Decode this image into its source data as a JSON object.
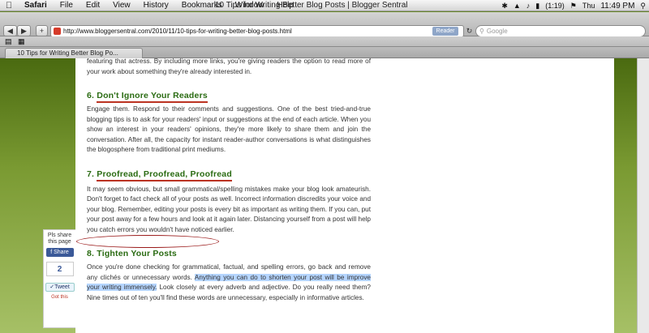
{
  "menubar": {
    "app": "Safari",
    "items": [
      "File",
      "Edit",
      "View",
      "History",
      "Bookmarks",
      "Window",
      "Help"
    ],
    "window_title": "10 Tips for Writing Better Blog Posts | Blogger Sentral",
    "battery": "(1:19)",
    "day": "Thu",
    "time": "11:49 PM"
  },
  "toolbar": {
    "url": "http://www.bloggersentral.com/2010/11/10-tips-for-writing-better-blog-posts.html",
    "reader_label": "Reader",
    "search_placeholder": "Google"
  },
  "tab": {
    "label": "10 Tips for Writing Better Blog Po..."
  },
  "article": {
    "intro": "featuring that actress. By including more links, you're giving readers the option to read more of your work about something they're already interested in.",
    "s6_heading": "6. Don't Ignore Your Readers",
    "s6_heading_text": "Don't Ignore Your Readers",
    "s6_body": "Engage them. Respond to their comments and suggestions. One of the best tried-and-true blogging tips is to ask for your readers' input or suggestions at the end of each article. When you show an interest in your readers' opinions, they're more likely to share them and join the conversation. After all, the capacity for instant reader-author conversations is what distinguishes the blogosphere from traditional print mediums.",
    "s7_heading_text": "Proofread, Proofread, Proofread",
    "s7_body": "It may seem obvious, but small grammatical/spelling mistakes make your blog look amateurish. Don't forget to fact check all of your posts as well. Incorrect information discredits your voice and your blog. Remember, editing your posts is every bit as important as writing them. If you can, put your post away for a few hours and look at it again later. Distancing yourself from a post will help you catch errors you wouldn't have noticed earlier.",
    "s8_heading": "8. Tighten Your Posts",
    "s8_body_a": "Once you're done checking for grammatical, factual, and spelling errors, go back and remove any clichés or unnecessary words. ",
    "s8_highlight": "Anything you can do to shorten your post will be improve your writing immensely.",
    "s8_body_b": " Look closely at every adverb and adjective. Do you really need them? Nine times out of ten you'll find these words are unnecessary, especially in informative articles."
  },
  "share": {
    "title": "Pls share this page",
    "facebook_label": "Share",
    "count": "2",
    "tweet_label": "Tweet",
    "got_this": "Got this"
  }
}
